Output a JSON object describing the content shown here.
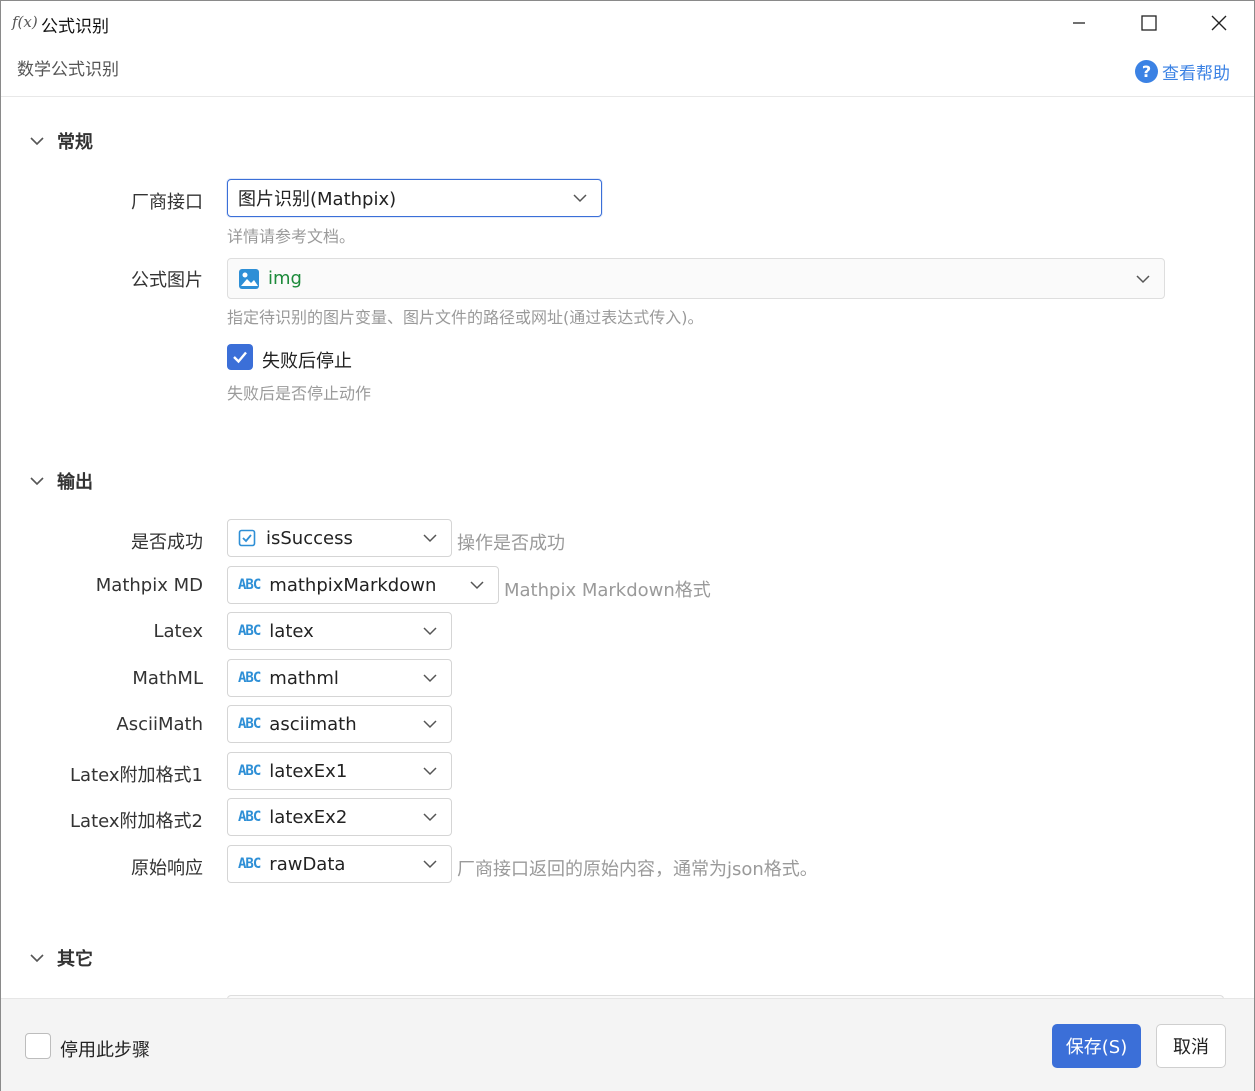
{
  "window": {
    "icon_text": "f(x)",
    "title": "公式识别",
    "subtitle": "数学公式识别",
    "help_label": "查看帮助"
  },
  "sections": {
    "general": "常规",
    "output": "输出",
    "other": "其它"
  },
  "general": {
    "vendor_label": "厂商接口",
    "vendor_value": "图片识别(Mathpix)",
    "vendor_hint": "详情请参考文档。",
    "image_label": "公式图片",
    "image_value": "img",
    "image_hint": "指定待识别的图片变量、图片文件的路径或网址(通过表达式传入)。",
    "stop_on_fail_label": "失败后停止",
    "stop_on_fail_checked": true,
    "stop_on_fail_hint": "失败后是否停止动作"
  },
  "output": {
    "rows": [
      {
        "label": "是否成功",
        "icon": "checkbox-var-icon",
        "value": "isSuccess",
        "hint": "操作是否成功"
      },
      {
        "label": "Mathpix MD",
        "icon": "ABC",
        "value": "mathpixMarkdown",
        "hint": "Mathpix Markdown格式"
      },
      {
        "label": "Latex",
        "icon": "ABC",
        "value": "latex",
        "hint": ""
      },
      {
        "label": "MathML",
        "icon": "ABC",
        "value": "mathml",
        "hint": ""
      },
      {
        "label": "AsciiMath",
        "icon": "ABC",
        "value": "asciimath",
        "hint": ""
      },
      {
        "label": "Latex附加格式1",
        "icon": "ABC",
        "value": "latexEx1",
        "hint": ""
      },
      {
        "label": "Latex附加格式2",
        "icon": "ABC",
        "value": "latexEx2",
        "hint": ""
      },
      {
        "label": "原始响应",
        "icon": "ABC",
        "value": "rawData",
        "hint": "厂商接口返回的原始内容，通常为json格式。"
      }
    ]
  },
  "footer": {
    "disable_label": "停用此步骤",
    "disable_checked": false,
    "save_label": "保存(S)",
    "cancel_label": "取消"
  },
  "colors": {
    "accent": "#3b6fd8",
    "link": "#3b82e4",
    "var_icon": "#2e8fd6",
    "image_var": "#1c8a3a",
    "hint": "#9a9a9a"
  }
}
